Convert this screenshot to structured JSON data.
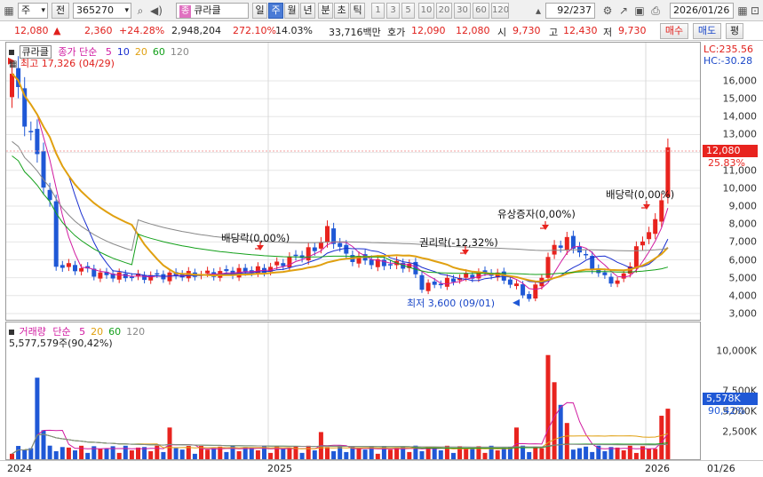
{
  "toolbar": {
    "market_sel": "주",
    "market_arrow": "▾",
    "prev_label": "전",
    "code": "365270",
    "code_arrow": "▾",
    "name_tag": "종",
    "name": "큐라클",
    "periods": [
      "일",
      "주",
      "월",
      "년",
      "분",
      "초",
      "틱"
    ],
    "active_period": "주",
    "intervals": [
      "1",
      "3",
      "5",
      "10",
      "20",
      "30",
      "60",
      "120"
    ],
    "count": "92",
    "total": "/237",
    "date": "2026/01/26"
  },
  "quote": {
    "price": "12,080",
    "change_arrow": "▲",
    "change": "2,360",
    "change_pct": "+24.28%",
    "volume": "2,948,204",
    "vol_ratio": "272.10%",
    "turnover": "14.03%",
    "amount": "33,716백만",
    "bid_label": "호가",
    "bid": "12,090",
    "ask": "12,080",
    "open_label": "시",
    "open": "9,730",
    "high_label": "고",
    "high": "12,430",
    "low_label": "저",
    "low": "9,730",
    "buy_label": "매수",
    "sell_label": "매도",
    "eval_label": "평"
  },
  "price_panel": {
    "name": "큐라클",
    "legend_label": "종가 단순",
    "ma_periods": [
      "5",
      "10",
      "20",
      "60",
      "120"
    ],
    "ma_colors": [
      "#d01aa0",
      "#1a2fd0",
      "#e0a010",
      "#13a01a",
      "#888888"
    ],
    "max_label": "최고 17,326 (04/29)",
    "min_label": "최저 3,600 (09/01)",
    "lc": "LC:235.56",
    "hc": "HC:-30.28",
    "current_price": "12,080",
    "current_pct": "25.83%",
    "y_ticks": [
      "16,000",
      "15,000",
      "14,000",
      "13,000",
      "12,000",
      "11,000",
      "10,000",
      "9,000",
      "8,000",
      "7,000",
      "6,000",
      "5,000",
      "4,000",
      "3,000"
    ],
    "annotations": [
      "배당락(0,00%)",
      "권리락(-12,32%)",
      "유상증자(0,00%)",
      "배당락(0,00%)"
    ]
  },
  "volume_panel": {
    "name": "거래량",
    "legend_label": "단순",
    "ma_periods": [
      "5",
      "20",
      "60",
      "120"
    ],
    "summary": "5,577,579주(90,42%)",
    "current_volume": "5,578K",
    "current_pct": "90,42%",
    "y_ticks": [
      "10,000K",
      "7,500K",
      "5,000K",
      "2,500K"
    ]
  },
  "x_axis": {
    "labels": [
      "2024",
      "2025",
      "2026"
    ],
    "last_date": "01/26"
  },
  "colors": {
    "up": "#e8231e",
    "down": "#1f58d6",
    "accent": "#4a7bd6"
  }
}
